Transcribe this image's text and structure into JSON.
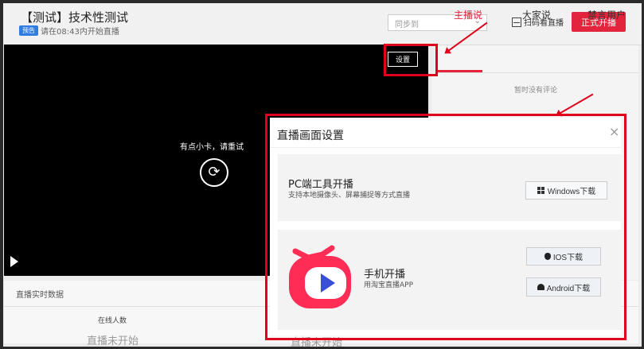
{
  "header": {
    "title": "【测试】技术性测试",
    "badge": "预告",
    "subtitle": "请在08:43内开始直播",
    "sync_select": {
      "value": "同步到"
    },
    "scan_label": "扫码看直播",
    "go_live_label": "正式开播"
  },
  "player": {
    "settings_label": "设置",
    "stall_message": "有点小卡，请重试"
  },
  "tabs": [
    {
      "label": "主播说",
      "active": true
    },
    {
      "label": "大家说",
      "active": false
    },
    {
      "label": "禁言用户",
      "active": false
    }
  ],
  "comments": {
    "empty_text": "暂时没有评论"
  },
  "stats": {
    "title": "直播实时数据",
    "online_label": "在线人数",
    "value1": "直播未开始",
    "value2": "直播未开始"
  },
  "modal": {
    "title": "直播画面设置",
    "pc": {
      "title": "PC端工具开播",
      "desc": "支持本地摄像头、屏幕捕捉等方式直播",
      "windows_btn": "Windows下载"
    },
    "mobile": {
      "title": "手机开播",
      "desc": "用淘宝直播APP",
      "ios_btn": "IOS下载",
      "android_btn": "Android下载"
    }
  },
  "colors": {
    "accent": "#e2243c",
    "highlight": "#e0001b",
    "badge": "#2f7de1",
    "app_icon": "#ff2d55",
    "app_play": "#3a4fd8"
  },
  "icons": [
    "scan-icon",
    "reload-icon",
    "play-icon",
    "close-icon",
    "windows-icon",
    "apple-icon",
    "android-icon",
    "taobao-live-app-icon",
    "chevron-down-icon"
  ]
}
